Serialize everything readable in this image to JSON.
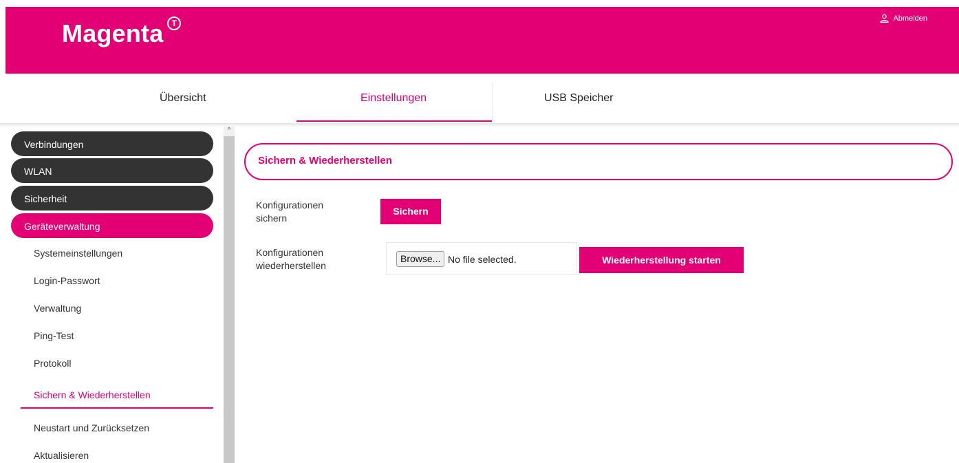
{
  "header": {
    "brand": "Magenta",
    "brand_mark": "T",
    "logout_label": "Abmelden",
    "brand_color": "#e20074"
  },
  "topnav": {
    "tabs": [
      {
        "label": "Übersicht",
        "active": false
      },
      {
        "label": "Einstellungen",
        "active": true
      },
      {
        "label": "USB Speicher",
        "active": false
      }
    ]
  },
  "sidebar": {
    "sections": [
      {
        "label": "Verbindungen",
        "active": false
      },
      {
        "label": "WLAN",
        "active": false
      },
      {
        "label": "Sicherheit",
        "active": false
      },
      {
        "label": "Geräteverwaltung",
        "active": true
      }
    ],
    "subitems": [
      {
        "label": "Systemeinstellungen",
        "active": false
      },
      {
        "label": "Login-Passwort",
        "active": false
      },
      {
        "label": "Verwaltung",
        "active": false
      },
      {
        "label": "Ping-Test",
        "active": false
      },
      {
        "label": "Protokoll",
        "active": false
      },
      {
        "label": "Sichern & Wiederherstellen",
        "active": true
      },
      {
        "label": "Neustart und Zurücksetzen",
        "active": false
      },
      {
        "label": "Aktualisieren",
        "active": false
      }
    ]
  },
  "main": {
    "section_title": "Sichern & Wiederherstellen",
    "backup": {
      "label_line1": "Konfigurationen",
      "label_line2": "sichern",
      "button": "Sichern"
    },
    "restore": {
      "label_line1": "Konfigurationen",
      "label_line2": "wiederherstellen",
      "browse_button": "Browse...",
      "file_status": "No file selected.",
      "button": "Wiederherstellung starten"
    }
  }
}
